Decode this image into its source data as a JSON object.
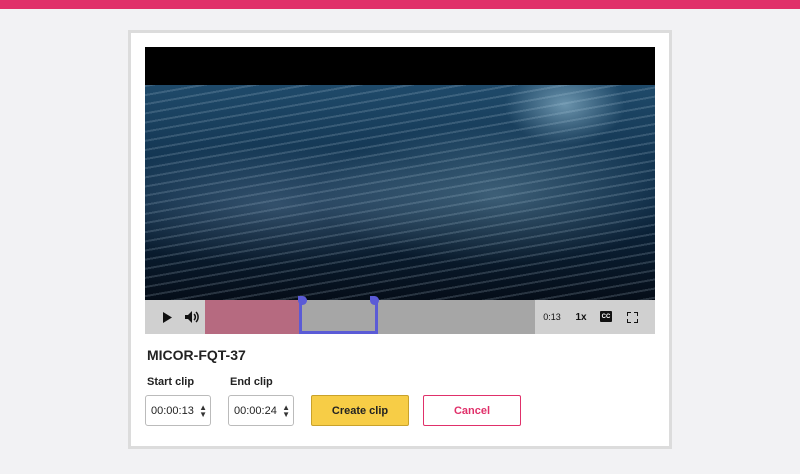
{
  "video": {
    "time": "0:13",
    "speed": "1x",
    "cc_label": "CC",
    "progress_fraction": 0.29,
    "clip_start_fraction": 0.29,
    "clip_end_fraction": 0.53
  },
  "title": "MICOR-FQT-37",
  "start_clip": {
    "label": "Start clip",
    "value": "00:00:13"
  },
  "end_clip": {
    "label": "End clip",
    "value": "00:00:24"
  },
  "create_label": "Create clip",
  "cancel_label": "Cancel",
  "colors": {
    "accent": "#e0306a",
    "create": "#f7cd46",
    "selection": "#5b5bd6"
  }
}
